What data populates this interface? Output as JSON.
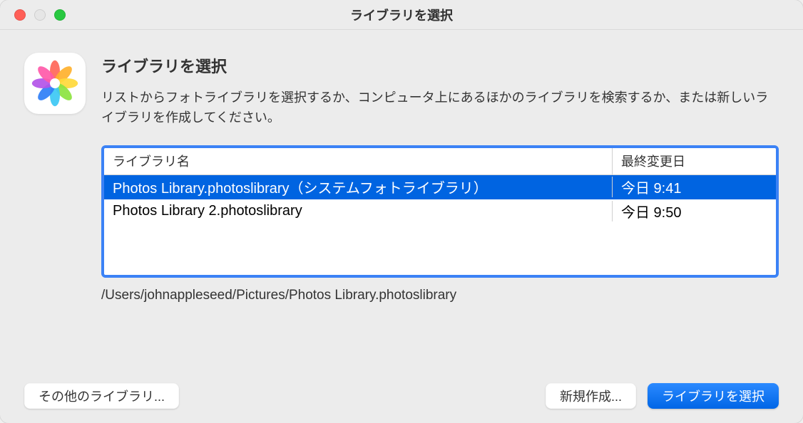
{
  "window": {
    "title": "ライブラリを選択"
  },
  "header": {
    "title": "ライブラリを選択",
    "description": "リストからフォトライブラリを選択するか、コンピュータ上にあるほかのライブラリを検索するか、または新しいライブラリを作成してください。"
  },
  "table": {
    "columns": {
      "name": "ライブラリ名",
      "modified": "最終変更日"
    },
    "rows": [
      {
        "name": "Photos Library.photoslibrary（システムフォトライブラリ）",
        "modified": "今日 9:41",
        "selected": true
      },
      {
        "name": "Photos Library 2.photoslibrary",
        "modified": "今日 9:50",
        "selected": false
      }
    ]
  },
  "path": "/Users/johnappleseed/Pictures/Photos Library.photoslibrary",
  "buttons": {
    "other": "その他のライブラリ...",
    "create": "新規作成...",
    "choose": "ライブラリを選択"
  }
}
